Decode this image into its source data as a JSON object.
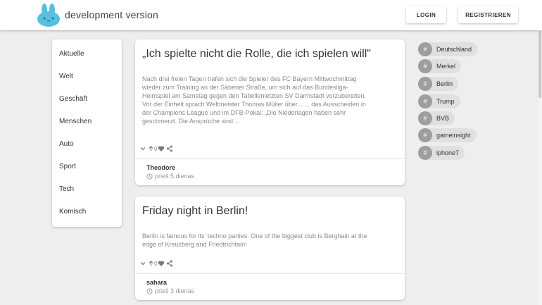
{
  "header": {
    "brand": "development version",
    "login_label": "LOGIN",
    "register_label": "REGISTRIEREN",
    "logo_icon": "bunny-logo-icon",
    "accent": "#55c0e0"
  },
  "sidebar": {
    "items": [
      {
        "label": "Aktuelle"
      },
      {
        "label": "Welt"
      },
      {
        "label": "Geschäft"
      },
      {
        "label": "Menschen"
      },
      {
        "label": "Auto"
      },
      {
        "label": "Sport"
      },
      {
        "label": "Tech"
      },
      {
        "label": "Komisch"
      }
    ]
  },
  "posts": [
    {
      "title": "„Ich spielte nicht die Rolle, die ich spielen will\"",
      "body": "Nach drei freien Tagen trafen sich die Spieler des FC Bayern Mittwochmittag wieder zum Training an der Säbener Straße, um sich auf das Bundesliga-Heimspiel am Samstag gegen den Tabellenletzten SV Darmstadt vorzubereiten. Vor der Einheit sprach Weltmeister Thomas Müller über... ... das Ausscheiden in der Champions League und im DFB-Pokal: „Die Niederlagen haben sehr geschmerzt. Die Ansprüche sind ...",
      "votes": "0",
      "author": "Theodore",
      "time": "prieš 5 dienas"
    },
    {
      "title": "Friday night in Berlin!",
      "body": "Berlin is famous for its' techno parties. One of the biggest club is Berghain at the edge of Kreuzberg and Friedtrichtain!",
      "votes": "0",
      "author": "sahara",
      "time": "prieš 3 dienas"
    }
  ],
  "tags": {
    "hash": "#",
    "items": [
      {
        "label": "Deutschland"
      },
      {
        "label": "Merkel"
      },
      {
        "label": "Berlin"
      },
      {
        "label": "Trump"
      },
      {
        "label": "BVB"
      },
      {
        "label": "gameinsight"
      },
      {
        "label": "iphone7"
      }
    ]
  }
}
